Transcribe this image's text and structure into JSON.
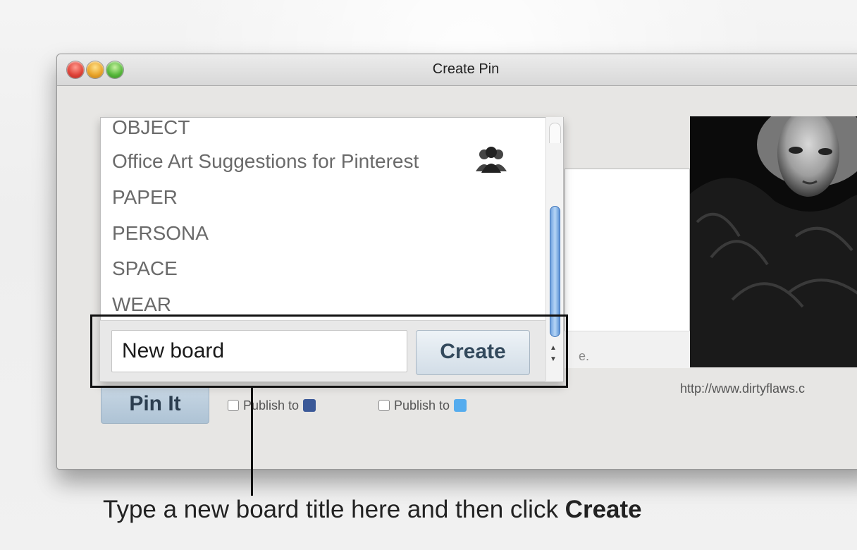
{
  "window": {
    "title": "Create Pin"
  },
  "boards": {
    "items": [
      {
        "label": "OBJECT",
        "shared": false
      },
      {
        "label": "Office Art Suggestions for Pinterest",
        "shared": true
      },
      {
        "label": "PAPER",
        "shared": false
      },
      {
        "label": "PERSONA",
        "shared": false
      },
      {
        "label": "SPACE",
        "shared": false
      },
      {
        "label": "WEAR",
        "shared": false
      }
    ],
    "shared_icon": "people-group-icon"
  },
  "new_board": {
    "value": "New board",
    "create_label": "Create"
  },
  "description": {
    "hint_fragment": "e."
  },
  "actions": {
    "pin_label": "Pin It",
    "publish_facebook_label": "Publish to",
    "publish_twitter_label": "Publish to",
    "facebook_icon": "facebook-icon",
    "twitter_icon": "twitter-icon"
  },
  "preview": {
    "url": "http://www.dirtyflaws.c"
  },
  "annotation": {
    "caption_prefix": "Type a new board title here and then click ",
    "caption_bold": "Create"
  },
  "colors": {
    "scroll_thumb": "#6fa2df",
    "facebook": "#3b5998",
    "twitter": "#55acee"
  }
}
